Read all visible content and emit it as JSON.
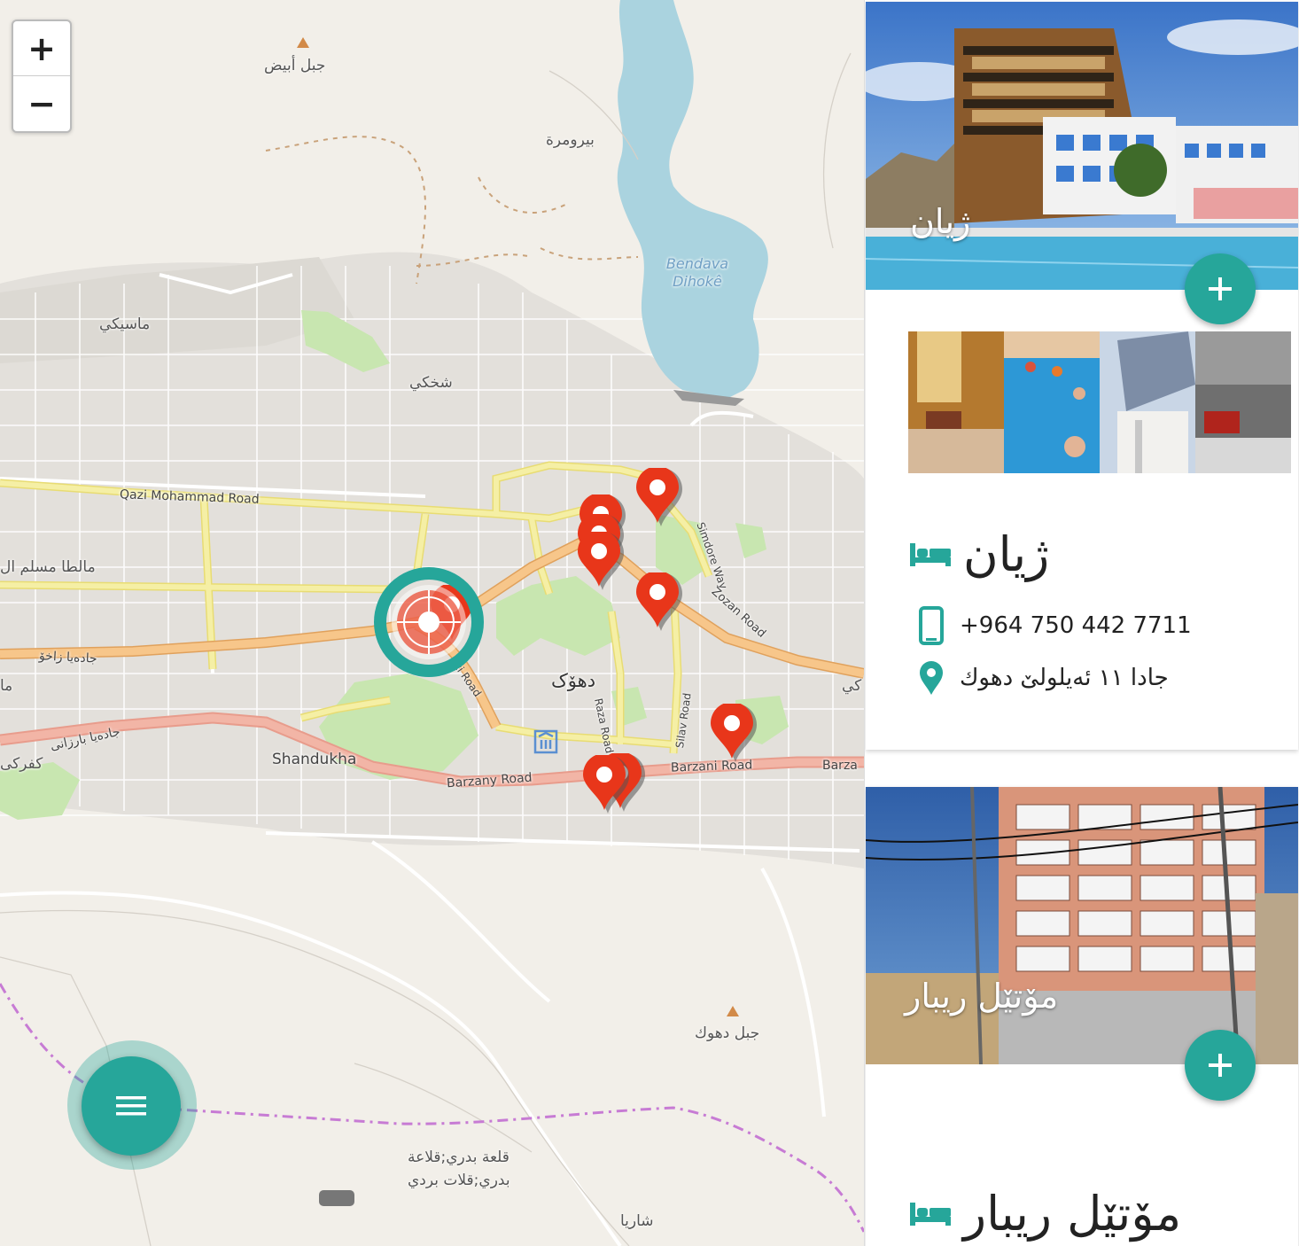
{
  "map": {
    "zoom_in_label": "+",
    "zoom_out_label": "−",
    "labels": {
      "jabal_abyad": "جبل أبيض",
      "biruma": "بيرومرة",
      "bendava": "Bendava",
      "dihoke": "Dihokê",
      "masiki": "ماسيكي",
      "shakhki": "شخكي",
      "qazi_road": "Qazi Mohammad Road",
      "malta": "مالطا مسلم ال",
      "zakho": "جادەیا زاخۆ",
      "duhok": "دهۆک",
      "shandukha": "Shandukha",
      "barzani_ar": "جادەیا بارزانی",
      "kafarki": "کفرکی",
      "barzany_road": "Barzany Road",
      "barzani_road": "Barzani Road",
      "barza": "Barza",
      "simdore": "Simdore Way",
      "zozan": "Zozan Road",
      "raza": "Raza Road",
      "silav": "Silav Road",
      "zi_road": "zi Road",
      "jabal_duhok": "جبل دهوك",
      "qalaa": "قلعة بدري;قلاعة",
      "badri": "بدري;قلات بردي",
      "sharya": "شاريا",
      "side_a": "ما",
      "side_ki": "کي"
    }
  },
  "hotels": [
    {
      "name": "ژیان",
      "hero_title": "ژيان",
      "phone": "+964 750 442 7711",
      "address": "جادا ١١ ئەيلولێ دهوك",
      "add_label": "+"
    },
    {
      "name": "مۆتێل ريبار",
      "hero_title": "مۆتێل ريبار",
      "add_label": "+"
    }
  ],
  "icons": {
    "menu": "menu-icon",
    "bed": "bed-icon",
    "phone": "phone-icon",
    "pin": "location-pin-icon",
    "plus": "plus-icon",
    "locator": "my-location-icon"
  },
  "colors": {
    "accent": "#26a69a",
    "marker": "#e8361a",
    "water": "#aad3df",
    "park": "#c8e6b0",
    "road_major": "#f7c68a",
    "road_secondary": "#f4ee9c"
  }
}
